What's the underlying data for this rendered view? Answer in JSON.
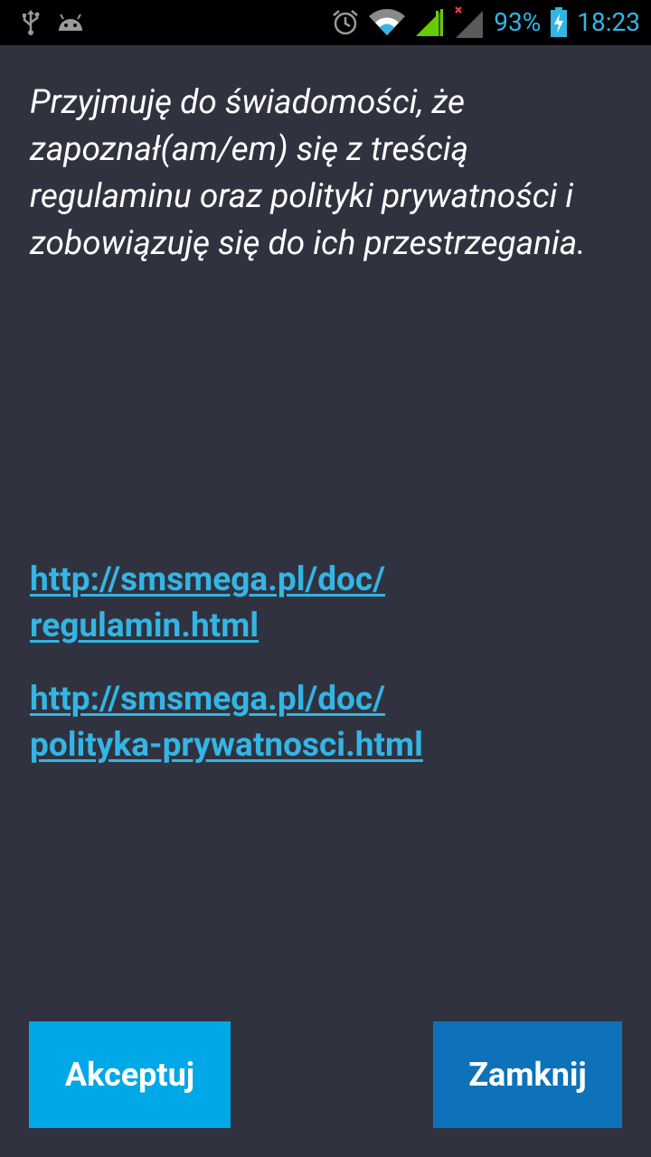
{
  "status_bar": {
    "battery_percent": "93%",
    "time": "18:23",
    "left_icons": [
      "usb-icon",
      "android-debug-icon"
    ],
    "right_icons": [
      "alarm-icon",
      "wifi-icon",
      "signal-icon",
      "signal-no-data-icon",
      "battery-charging-icon"
    ],
    "accent_color": "#33b5e5"
  },
  "main": {
    "consent_text": "Przyjmuję do świadomości, że zapoznał(am/em) się z treścią regulaminu oraz polityki prywatności i zobowiązuję się do ich przestrzegania.",
    "links": [
      {
        "line1": "http://smsmega.pl/doc/",
        "line2": "regulamin.html"
      },
      {
        "line1": "http://smsmega.pl/doc/",
        "line2": "polityka-prywatnosci.html"
      }
    ]
  },
  "buttons": {
    "accept_label": "Akceptuj",
    "close_label": "Zamknij",
    "accept_color": "#00a8e8",
    "close_color": "#0d72b9"
  },
  "colors": {
    "background": "#30333f",
    "status_bar": "#000000",
    "text": "#ffffff",
    "link": "#33b5e5"
  }
}
